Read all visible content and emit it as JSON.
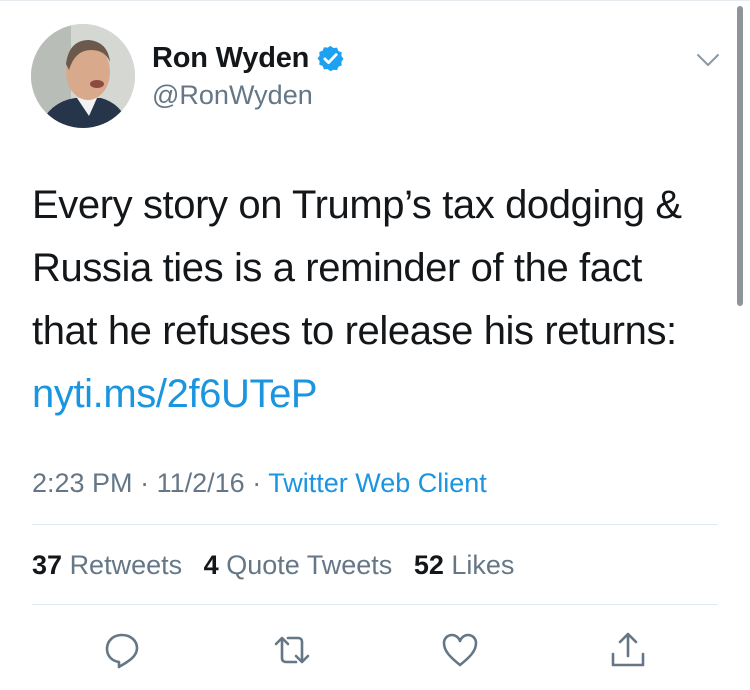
{
  "tweet": {
    "author": {
      "display_name": "Ron Wyden",
      "handle": "@RonWyden",
      "verified": true,
      "avatar_icon": "profile-photo"
    },
    "text_lines": [
      "Every story on Trump’s tax dodging &",
      "Russia ties is a reminder of the fact",
      "that he refuses to release his returns:"
    ],
    "link": "nyti.ms/2f6UTeP",
    "time": "2:23 PM",
    "date": "11/2/16",
    "separator": "·",
    "client": "Twitter Web Client",
    "stats": {
      "retweets_count": "37",
      "retweets_label": "Retweets",
      "quote_count": "4",
      "quote_label": "Quote Tweets",
      "likes_count": "52",
      "likes_label": "Likes"
    },
    "actions": [
      "reply-icon",
      "retweet-icon",
      "like-icon",
      "share-icon"
    ]
  },
  "colors": {
    "accent": "#1b95e0",
    "secondary_text": "#657786",
    "primary_text": "#14171a",
    "divider": "#e1e8ed"
  }
}
